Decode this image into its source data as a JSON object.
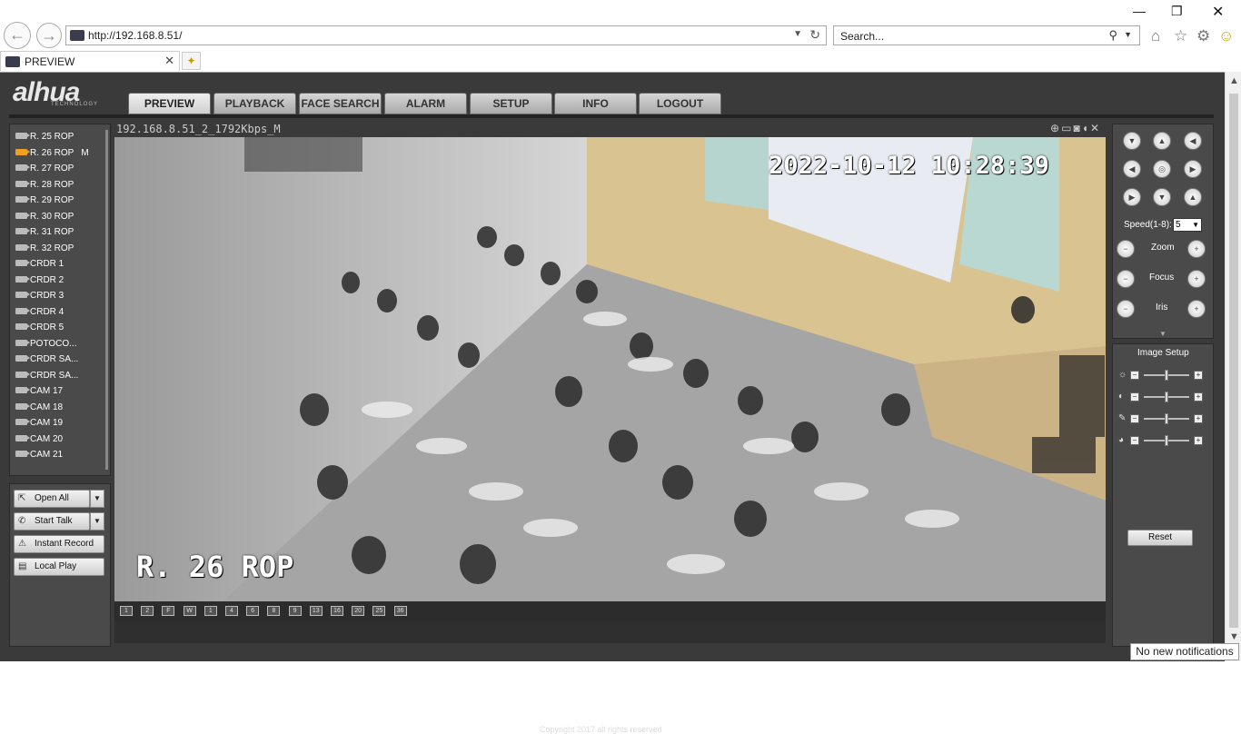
{
  "browser": {
    "url": "http://192.168.8.51/",
    "search_placeholder": "Search...",
    "tab_title": "PREVIEW",
    "notification": "No new notifications"
  },
  "app": {
    "logo": "alhua",
    "logo_sub": "TECHNOLOGY",
    "nav": [
      "PREVIEW",
      "PLAYBACK",
      "FACE SEARCH",
      "ALARM",
      "SETUP",
      "INFO",
      "LOGOUT"
    ],
    "active_nav": "PREVIEW"
  },
  "cameras": [
    {
      "name": "R. 25 ROP"
    },
    {
      "name": "R. 26 ROP",
      "suffix": "M",
      "selected": true
    },
    {
      "name": "R. 27 ROP"
    },
    {
      "name": "R. 28 ROP"
    },
    {
      "name": "R. 29 ROP"
    },
    {
      "name": "R. 30 ROP"
    },
    {
      "name": "R. 31 ROP"
    },
    {
      "name": "R. 32 ROP"
    },
    {
      "name": "CRDR 1"
    },
    {
      "name": "CRDR 2"
    },
    {
      "name": "CRDR 3"
    },
    {
      "name": "CRDR 4"
    },
    {
      "name": "CRDR 5"
    },
    {
      "name": "POTOCO..."
    },
    {
      "name": "CRDR SA..."
    },
    {
      "name": "CRDR SA..."
    },
    {
      "name": "CAM 17"
    },
    {
      "name": "CAM 18"
    },
    {
      "name": "CAM 19"
    },
    {
      "name": "CAM 20"
    },
    {
      "name": "CAM 21"
    }
  ],
  "controls": {
    "open_all": "Open All",
    "start_talk": "Start Talk",
    "instant_record": "Instant Record",
    "local_play": "Local Play"
  },
  "video": {
    "stream_title": "192.168.8.51_2_1792Kbps_M",
    "timestamp": "2022-10-12 10:28:39",
    "channel_label": "R. 26 ROP",
    "layout_buttons": [
      "1",
      "2",
      "F",
      "W",
      "1",
      "4",
      "6",
      "8",
      "9",
      "13",
      "16",
      "20",
      "25",
      "36"
    ]
  },
  "ptz": {
    "speed_label": "Speed(1-8):",
    "speed_value": "5",
    "zoom": "Zoom",
    "focus": "Focus",
    "iris": "Iris"
  },
  "image_setup": {
    "title": "Image Setup",
    "reset": "Reset"
  },
  "footer": {
    "copyright": "Copyright 2017 all rights reserved"
  }
}
